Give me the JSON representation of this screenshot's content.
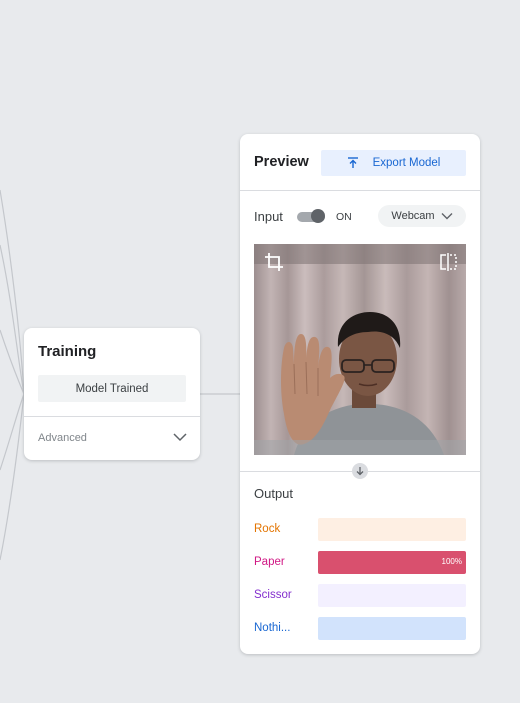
{
  "training": {
    "title": "Training",
    "status_button": "Model Trained",
    "advanced_label": "Advanced"
  },
  "preview": {
    "title": "Preview",
    "export_label": "Export Model",
    "input_label": "Input",
    "toggle_state": "ON",
    "source": "Webcam",
    "output_label": "Output"
  },
  "output_classes": [
    {
      "name": "Rock",
      "confidence": 0,
      "percent_label": "",
      "text_color": "#e37400",
      "track_color": "#feefe3",
      "fill_color": "#f5a35c"
    },
    {
      "name": "Paper",
      "confidence": 1.0,
      "percent_label": "100%",
      "text_color": "#d01884",
      "track_color": "#fce8f1",
      "fill_color": "#d9506e"
    },
    {
      "name": "Scissor",
      "confidence": 0,
      "percent_label": "",
      "text_color": "#8430ce",
      "track_color": "#f3f0ff",
      "fill_color": "#a66df7"
    },
    {
      "name": "Nothi...",
      "confidence": 0,
      "percent_label": "",
      "text_color": "#1967d2",
      "track_color": "#d2e3fc",
      "fill_color": "#4285f4"
    }
  ],
  "icons": {
    "export": "upload-arrow-icon",
    "crop": "crop-icon",
    "flip": "flip-horizontal-icon",
    "dropdown": "chevron-down-icon",
    "expand": "arrow-down-icon"
  }
}
